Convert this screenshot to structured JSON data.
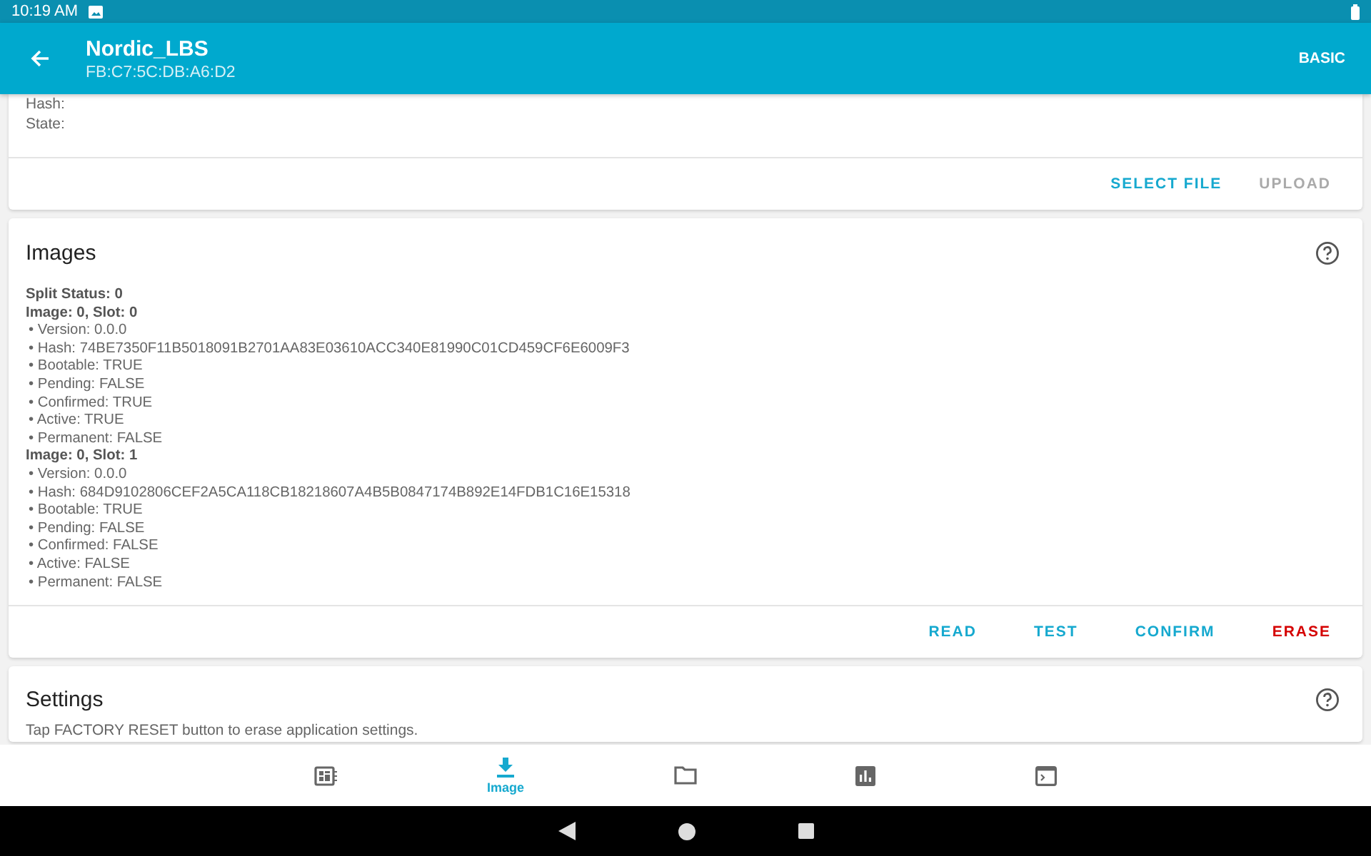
{
  "status_bar": {
    "time": "10:19 AM"
  },
  "app_bar": {
    "title": "Nordic_LBS",
    "subtitle": "FB:C7:5C:DB:A6:D2",
    "action": "BASIC"
  },
  "upload_card": {
    "lines": [
      "Hash:",
      "State:"
    ],
    "buttons": [
      {
        "label": "SELECT FILE",
        "kind": "primary"
      },
      {
        "label": "UPLOAD",
        "kind": "disabled"
      }
    ]
  },
  "images_card": {
    "title": "Images",
    "lines": [
      {
        "text": "Split Status: 0",
        "kind": "heading"
      },
      {
        "text": "Image: 0, Slot: 0",
        "kind": "heading"
      },
      {
        "text": "• Version: 0.0.0",
        "kind": "bullet"
      },
      {
        "text": "• Hash: 74BE7350F11B5018091B2701AA83E03610ACC340E81990C01CD459CF6E6009F3",
        "kind": "bullet"
      },
      {
        "text": "• Bootable: TRUE",
        "kind": "bullet"
      },
      {
        "text": "• Pending: FALSE",
        "kind": "bullet"
      },
      {
        "text": "• Confirmed: TRUE",
        "kind": "bullet"
      },
      {
        "text": "• Active: TRUE",
        "kind": "bullet"
      },
      {
        "text": "• Permanent: FALSE",
        "kind": "bullet"
      },
      {
        "text": "Image: 0, Slot: 1",
        "kind": "heading"
      },
      {
        "text": "• Version: 0.0.0",
        "kind": "bullet"
      },
      {
        "text": "• Hash: 684D9102806CEF2A5CA118CB18218607A4B5B0847174B892E14FDB1C16E15318",
        "kind": "bullet"
      },
      {
        "text": "• Bootable: TRUE",
        "kind": "bullet"
      },
      {
        "text": "• Pending: FALSE",
        "kind": "bullet"
      },
      {
        "text": "• Confirmed: FALSE",
        "kind": "bullet"
      },
      {
        "text": "• Active: FALSE",
        "kind": "bullet"
      },
      {
        "text": "• Permanent: FALSE",
        "kind": "bullet"
      }
    ],
    "buttons": [
      {
        "label": "READ",
        "kind": "primary"
      },
      {
        "label": "TEST",
        "kind": "primary"
      },
      {
        "label": "CONFIRM",
        "kind": "primary"
      },
      {
        "label": "ERASE",
        "kind": "danger"
      }
    ]
  },
  "settings_card": {
    "title": "Settings",
    "text": "Tap FACTORY RESET button to erase application settings."
  },
  "bottom_nav": [
    {
      "kind": "device",
      "selected": false
    },
    {
      "kind": "image",
      "label": "Image",
      "selected": true
    },
    {
      "kind": "files",
      "selected": false
    },
    {
      "kind": "stats",
      "selected": false
    },
    {
      "kind": "logs",
      "selected": false
    }
  ]
}
